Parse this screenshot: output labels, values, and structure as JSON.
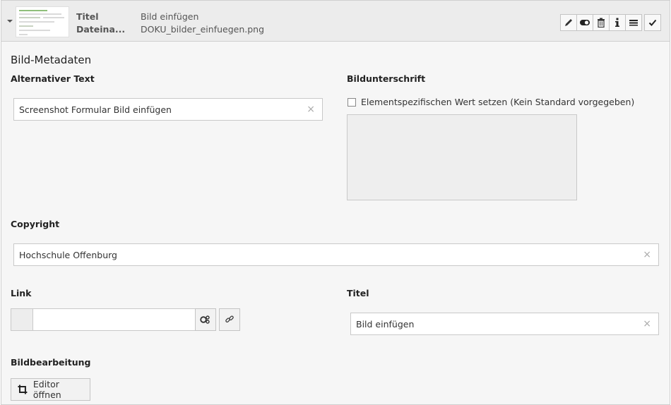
{
  "header": {
    "title_label": "Titel",
    "title_value": "Bild einfügen",
    "file_label": "Dateina...",
    "file_value": "DOKU_bilder_einfuegen.png",
    "toolbar": [
      "pencil-icon",
      "toggle-icon",
      "trash-icon",
      "info-icon",
      "menu-icon",
      "check-icon"
    ]
  },
  "section": {
    "title": "Bild-Metadaten"
  },
  "fields": {
    "alt_text": {
      "label": "Alternativer Text",
      "value": "Screenshot Formular Bild einfügen",
      "clear": "×"
    },
    "caption": {
      "label": "Bildunterschrift",
      "checkbox_label": "Elementspezifischen Wert setzen (Kein Standard vorgegeben)"
    },
    "copyright": {
      "label": "Copyright",
      "value": "Hochschule Offenburg",
      "clear": "×"
    },
    "link": {
      "label": "Link",
      "value": ""
    },
    "title": {
      "label": "Titel",
      "value": "Bild einfügen",
      "clear": "×"
    },
    "image_edit": {
      "label": "Bildbearbeitung",
      "button_label": "Editor öffnen"
    }
  }
}
